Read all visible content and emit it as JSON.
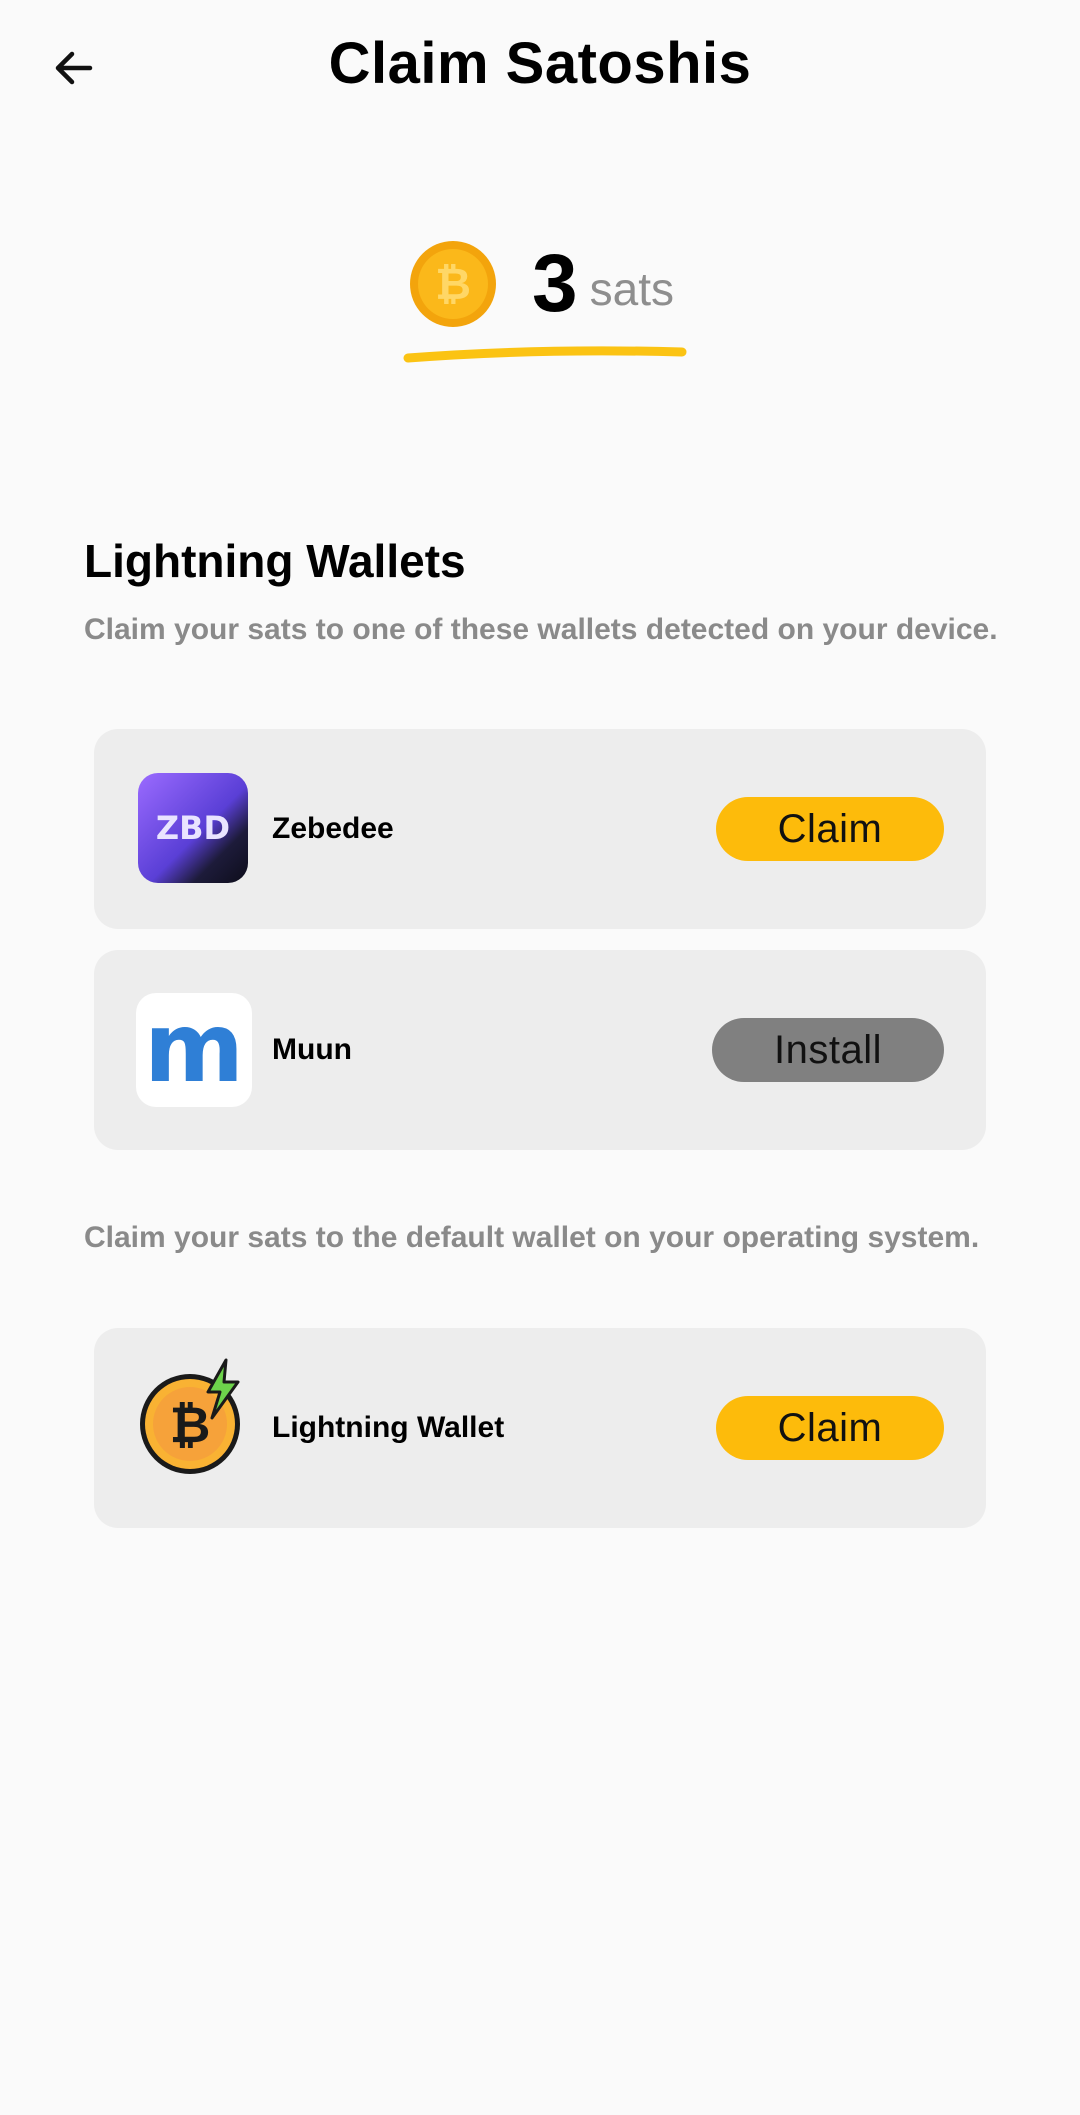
{
  "header": {
    "title": "Claim Satoshis",
    "back_icon": "arrow-left-icon"
  },
  "balance": {
    "amount": "3",
    "unit": "sats",
    "icon": "bitcoin-coin-icon",
    "accent_color": "#fdbb0b"
  },
  "lightning_section": {
    "title": "Lightning Wallets",
    "description": "Claim your sats to one of these wallets detected on your device."
  },
  "wallets": [
    {
      "name": "Zebedee",
      "icon_text": "ZBD",
      "action": "Claim"
    },
    {
      "name": "Muun",
      "icon_text": "m",
      "action": "Install"
    }
  ],
  "default_section": {
    "description": "Claim your sats to the default wallet on your operating system."
  },
  "default_wallet": {
    "name": "Lightning Wallet",
    "action": "Claim"
  },
  "colors": {
    "claim_button": "#fdbb0b",
    "install_button": "#808080",
    "card_background": "#ededed",
    "page_background": "#fafafa"
  }
}
